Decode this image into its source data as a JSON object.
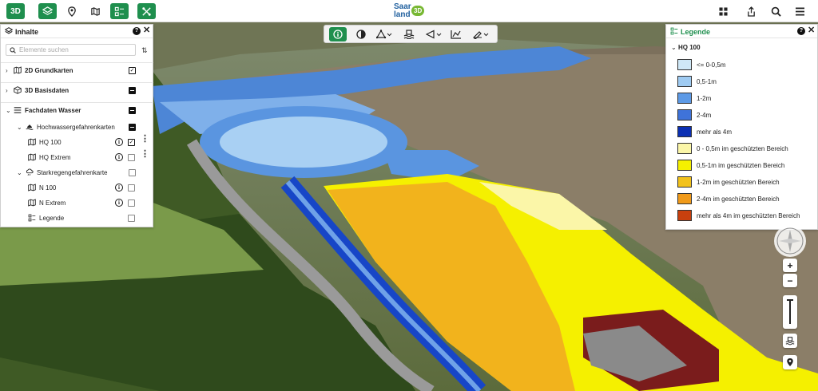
{
  "topbar": {
    "btn_3d": "3D",
    "logo_line1": "Saar",
    "logo_line2": "land",
    "logo_badge": "3D",
    "accent": "#1f8f4e"
  },
  "content_panel": {
    "title": "Inhalte",
    "search_placeholder": "Elemente suchen",
    "rows": [
      {
        "label": "2D Grundkarten"
      },
      {
        "label": "3D Basisdaten"
      },
      {
        "label": "Fachdaten Wasser"
      },
      {
        "label": "Hochwassergefahrenkarten"
      },
      {
        "label": "HQ 100"
      },
      {
        "label": "HQ Extrem"
      },
      {
        "label": "Starkregengefahrenkarte"
      },
      {
        "label": "N 100"
      },
      {
        "label": "N Extrem"
      },
      {
        "label": "Legende"
      }
    ]
  },
  "legend_panel": {
    "title": "Legende",
    "group": "HQ 100",
    "items": [
      {
        "label": "<= 0-0,5m",
        "color": "#cfe8f7"
      },
      {
        "label": "0,5-1m",
        "color": "#9fcbf2"
      },
      {
        "label": "1-2m",
        "color": "#5d9ae6"
      },
      {
        "label": "2-4m",
        "color": "#3f73d9"
      },
      {
        "label": "mehr als 4m",
        "color": "#0b2fb3"
      },
      {
        "label": "0 - 0,5m im geschützten Bereich",
        "color": "#fbf6a8"
      },
      {
        "label": "0,5-1m im geschützten Bereich",
        "color": "#f5f000"
      },
      {
        "label": "1-2m im geschützten Bereich",
        "color": "#f2c21c"
      },
      {
        "label": "2-4m im geschützten Bereich",
        "color": "#f09a1a"
      },
      {
        "label": "mehr als 4m im geschützten Bereich",
        "color": "#c8400e"
      }
    ]
  },
  "map_controls": {
    "zoom_in": "+",
    "zoom_out": "−"
  }
}
